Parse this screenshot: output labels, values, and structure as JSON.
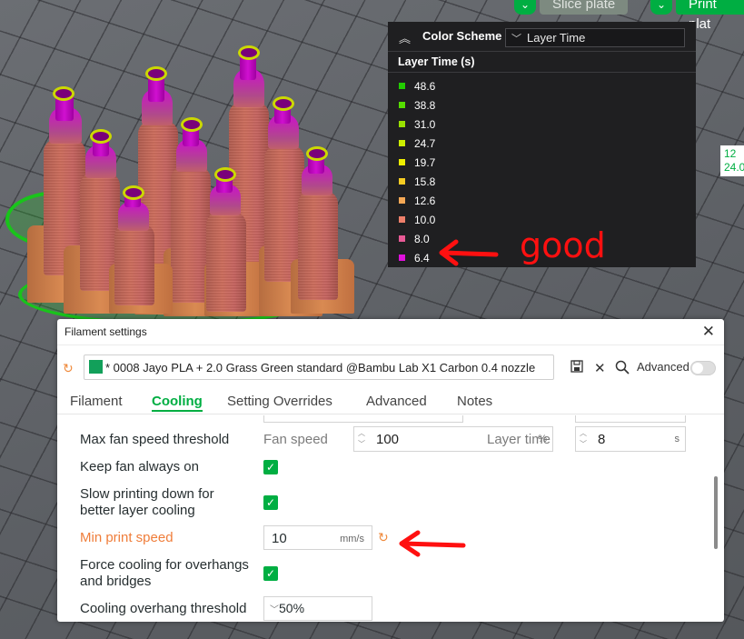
{
  "top_buttons": {
    "slice_plate": "Slice plate",
    "print_plate": "Print plat"
  },
  "side_readout": {
    "line1": "12",
    "line2": "24.0"
  },
  "legend": {
    "title": "Color Scheme",
    "selected_scheme": "Layer Time",
    "subheader": "Layer Time (s)",
    "items": [
      {
        "value": "48.6",
        "color": "#22cc00"
      },
      {
        "value": "38.8",
        "color": "#55dd00"
      },
      {
        "value": "31.0",
        "color": "#99e000"
      },
      {
        "value": "24.7",
        "color": "#ccee00"
      },
      {
        "value": "19.7",
        "color": "#eeee00"
      },
      {
        "value": "15.8",
        "color": "#f5cc22"
      },
      {
        "value": "12.6",
        "color": "#f5a855"
      },
      {
        "value": "10.0",
        "color": "#ee7f6a"
      },
      {
        "value": "8.0",
        "color": "#e85a96"
      },
      {
        "value": "6.4",
        "color": "#e011dd"
      }
    ]
  },
  "annotation": {
    "good_text": "good"
  },
  "dialog": {
    "title": "Filament settings",
    "preset": {
      "name": "* 0008 Jayo PLA + 2.0 Grass Green standard @Bambu Lab X1 Carbon 0.4 nozzle",
      "color": "#12a05a"
    },
    "advanced_label": "Advanced",
    "tabs": [
      "Filament",
      "Cooling",
      "Setting Overrides",
      "Advanced",
      "Notes"
    ],
    "active_tab": "Cooling",
    "rows": {
      "max_fan": {
        "label": "Max fan speed threshold",
        "fan_label": "Fan speed",
        "fan_value": "100",
        "fan_unit": "%",
        "layer_label": "Layer time",
        "layer_value": "8",
        "layer_unit": "s"
      },
      "keep_fan": {
        "label": "Keep fan always on",
        "checked": true
      },
      "slow_down": {
        "label_line1": "Slow printing down for",
        "label_line2": "better layer cooling",
        "checked": true
      },
      "min_speed": {
        "label": "Min print speed",
        "value": "10",
        "unit": "mm/s"
      },
      "force_cooling": {
        "label_line1": "Force cooling for overhangs",
        "label_line2": "and bridges",
        "checked": true
      },
      "overhang_threshold": {
        "label": "Cooling overhang threshold",
        "value": "50%"
      }
    }
  }
}
